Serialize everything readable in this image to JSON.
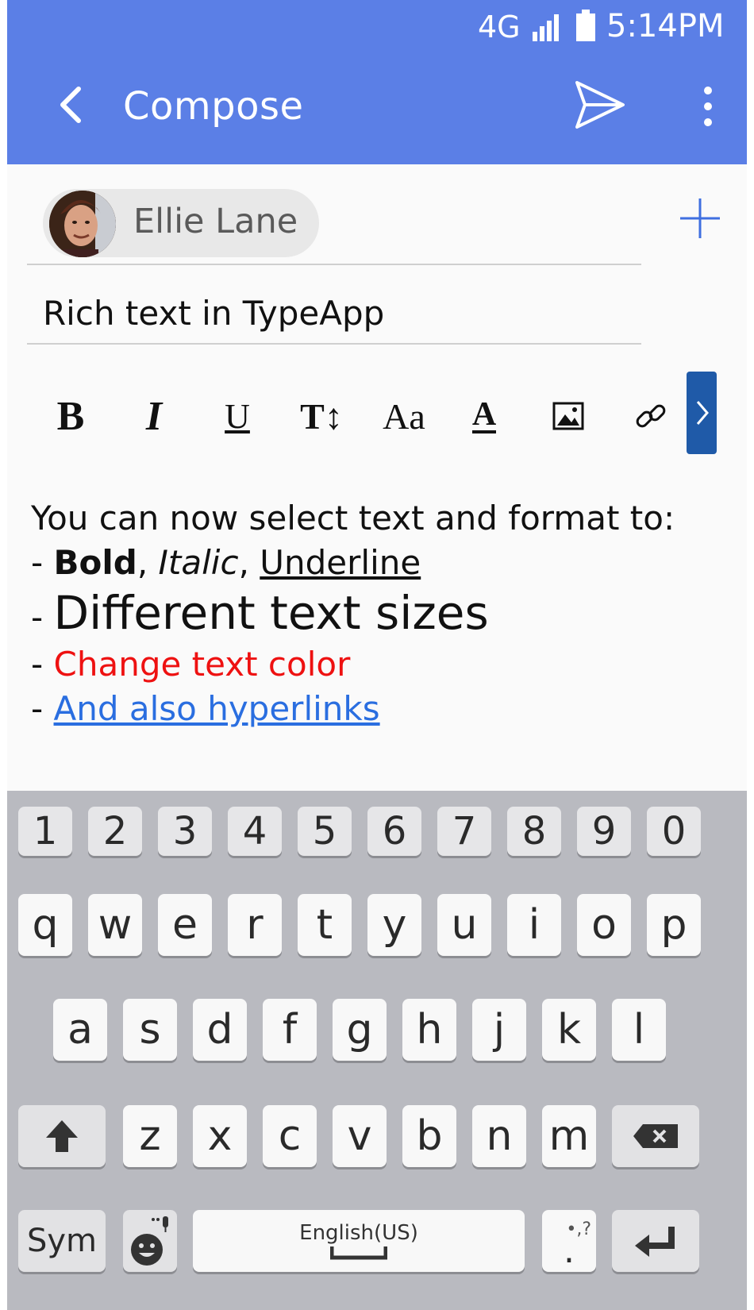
{
  "status_bar": {
    "network": "4G",
    "time": "5:14PM"
  },
  "app_bar": {
    "title": "Compose",
    "back_icon": "chevron-left-icon",
    "send_icon": "send-icon",
    "more_icon": "more-vert-icon"
  },
  "recipients": {
    "chips": [
      {
        "name": "Ellie Lane"
      }
    ],
    "add_icon": "plus-icon"
  },
  "subject": "Rich text in TypeApp",
  "toolbar": {
    "bold": "B",
    "italic": "I",
    "underline": "U",
    "text_size": "T↕",
    "font": "Aa",
    "color": "A",
    "image_icon": "image-icon",
    "link_icon": "link-icon",
    "more_icon": "chevron-right-icon"
  },
  "body": {
    "line1": "You can now select text and format to:",
    "line2_prefix": "- ",
    "line2_bold": "Bold",
    "line2_sep1": ", ",
    "line2_italic": "Italic",
    "line2_sep2": ", ",
    "line2_underline": "Underline",
    "line3_prefix": "- ",
    "line3_text": "Different text sizes",
    "line4_prefix": "- ",
    "line4_text": "Change text color",
    "line5_prefix": "- ",
    "line5_text": "And also hyperlinks",
    "colors": {
      "red": "#ee1111",
      "link": "#2a6ee0"
    }
  },
  "keyboard": {
    "numbers": [
      "1",
      "2",
      "3",
      "4",
      "5",
      "6",
      "7",
      "8",
      "9",
      "0"
    ],
    "row1": [
      "q",
      "w",
      "e",
      "r",
      "t",
      "y",
      "u",
      "i",
      "o",
      "p"
    ],
    "row2": [
      "a",
      "s",
      "d",
      "f",
      "g",
      "h",
      "j",
      "k",
      "l"
    ],
    "row3": [
      "z",
      "x",
      "c",
      "v",
      "b",
      "n",
      "m"
    ],
    "shift_icon": "shift-arrow-icon",
    "backspace_icon": "backspace-icon",
    "sym_label": "Sym",
    "emoji_icon": "emoji-mic-icon",
    "space_label": "English(US)",
    "punct_label": ".",
    "punct_hint": "•,?",
    "enter_icon": "enter-icon"
  },
  "colors": {
    "accent": "#5b7fe6",
    "toolbar_more": "#1f5aa8",
    "keyboard_bg": "#b9bac0"
  }
}
